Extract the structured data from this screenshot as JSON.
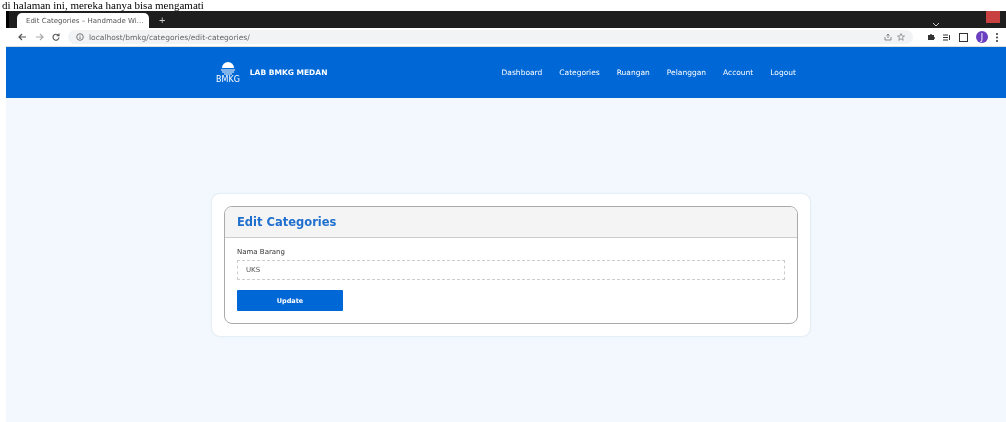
{
  "document_text": "di halaman ini, mereka hanya bisa mengamati",
  "browser": {
    "tab_title": "Edit Categories – Handmade Wi...",
    "new_tab": "+",
    "url": "localhost/bmkg/categories/edit-categories/",
    "profile_initial": "J"
  },
  "navbar": {
    "brand": "LAB BMKG MEDAN",
    "logo_caption": "BMKG",
    "links": [
      {
        "label": "Dashboard"
      },
      {
        "label": "Categories"
      },
      {
        "label": "Ruangan"
      },
      {
        "label": "Pelanggan"
      },
      {
        "label": "Account"
      },
      {
        "label": "Logout"
      }
    ]
  },
  "card": {
    "title": "Edit Categories",
    "field_label": "Nama Barang",
    "field_value": "UKS",
    "button": "Update"
  }
}
